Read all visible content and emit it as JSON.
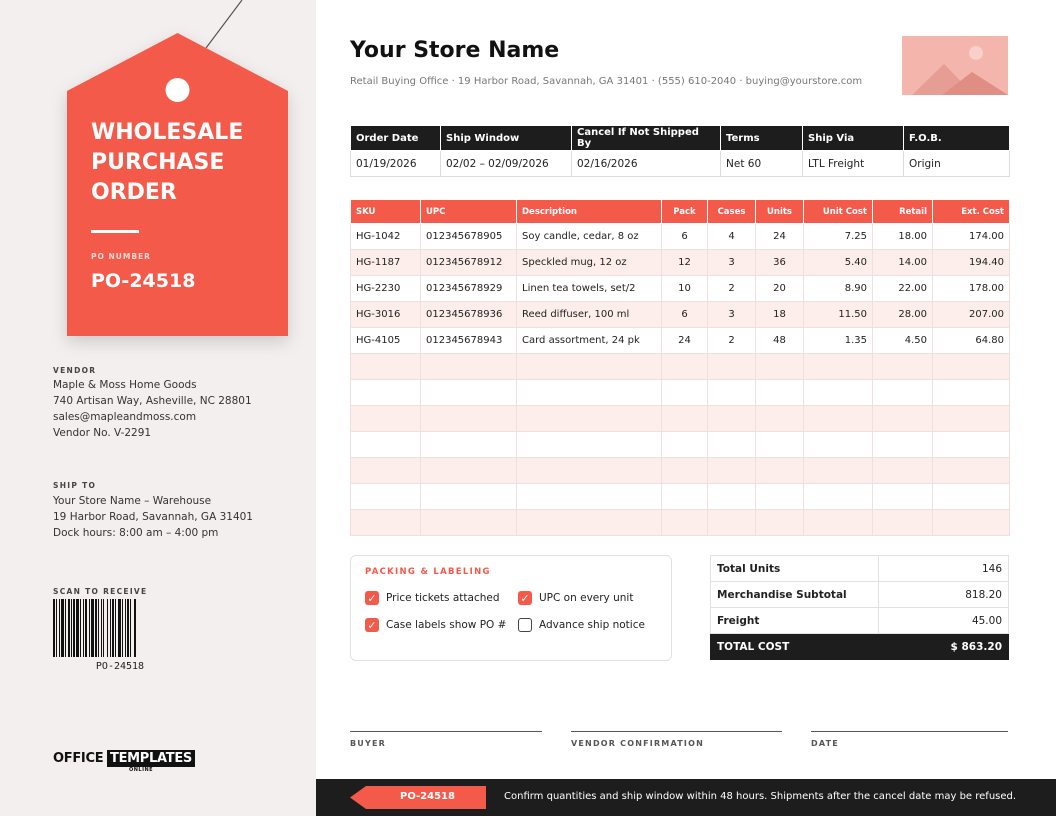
{
  "colors": {
    "accent": "#f45a4a",
    "dark": "#1d1d1d",
    "panel": "#f2efee",
    "row_tint": "#fdeeec"
  },
  "tag": {
    "title": "WHOLESALE\nPURCHASE\nORDER",
    "po_label": "PO NUMBER",
    "po_number": "PO-24518"
  },
  "vendor": {
    "label": "VENDOR",
    "lines": [
      "Maple & Moss Home Goods",
      "740 Artisan Way, Asheville, NC 28801",
      "sales@mapleandmoss.com",
      "Vendor No. V-2291"
    ]
  },
  "ship_to": {
    "label": "SHIP TO",
    "lines": [
      "Your Store Name – Warehouse",
      "19 Harbor Road, Savannah, GA 31401",
      "Dock hours: 8:00 am – 4:00 pm"
    ]
  },
  "scan": {
    "label": "SCAN TO RECEIVE",
    "code": "PO-24518"
  },
  "logo": {
    "office": "OFFICE",
    "templates": "TEMPLATES",
    "online": "ONLINE"
  },
  "store": {
    "name": "Your Store Name",
    "info": "Retail Buying Office  ·  19 Harbor Road, Savannah, GA 31401  ·  (555) 610-2040  ·  buying@yourstore.com",
    "image_icon": "image-placeholder-icon"
  },
  "terms": {
    "headers": [
      "Order Date",
      "Ship Window",
      "Cancel If Not Shipped By",
      "Terms",
      "Ship Via",
      "F.O.B."
    ],
    "values": [
      "01/19/2026",
      "02/02 – 02/09/2026",
      "02/16/2026",
      "Net 60",
      "LTL Freight",
      "Origin"
    ]
  },
  "items": {
    "headers": [
      "SKU",
      "UPC",
      "Description",
      "Pack",
      "Cases",
      "Units",
      "Unit Cost",
      "Retail",
      "Ext. Cost"
    ],
    "rows": [
      [
        "HG-1042",
        "012345678905",
        "Soy candle, cedar, 8 oz",
        "6",
        "4",
        "24",
        "7.25",
        "18.00",
        "174.00"
      ],
      [
        "HG-1187",
        "012345678912",
        "Speckled mug, 12 oz",
        "12",
        "3",
        "36",
        "5.40",
        "14.00",
        "194.40"
      ],
      [
        "HG-2230",
        "012345678929",
        "Linen tea towels, set/2",
        "10",
        "2",
        "20",
        "8.90",
        "22.00",
        "178.00"
      ],
      [
        "HG-3016",
        "012345678936",
        "Reed diffuser, 100 ml",
        "6",
        "3",
        "18",
        "11.50",
        "28.00",
        "207.00"
      ],
      [
        "HG-4105",
        "012345678943",
        "Card assortment, 24 pk",
        "24",
        "2",
        "48",
        "1.35",
        "4.50",
        "64.80"
      ],
      [
        "",
        "",
        "",
        "",
        "",
        "",
        "",
        "",
        ""
      ],
      [
        "",
        "",
        "",
        "",
        "",
        "",
        "",
        "",
        ""
      ],
      [
        "",
        "",
        "",
        "",
        "",
        "",
        "",
        "",
        ""
      ],
      [
        "",
        "",
        "",
        "",
        "",
        "",
        "",
        "",
        ""
      ],
      [
        "",
        "",
        "",
        "",
        "",
        "",
        "",
        "",
        ""
      ],
      [
        "",
        "",
        "",
        "",
        "",
        "",
        "",
        "",
        ""
      ],
      [
        "",
        "",
        "",
        "",
        "",
        "",
        "",
        "",
        ""
      ]
    ]
  },
  "packing": {
    "title": "PACKING & LABELING",
    "checks": [
      {
        "label": "Price tickets attached",
        "checked": true
      },
      {
        "label": "UPC on every unit",
        "checked": true
      },
      {
        "label": "Case labels show PO #",
        "checked": true
      },
      {
        "label": "Advance ship notice",
        "checked": false
      }
    ]
  },
  "totals": {
    "rows": [
      {
        "label": "Total Units",
        "value": "146"
      },
      {
        "label": "Merchandise Subtotal",
        "value": "818.20"
      },
      {
        "label": "Freight",
        "value": "45.00"
      }
    ],
    "grand_label": "TOTAL COST",
    "grand_value": "$ 863.20"
  },
  "signatures": [
    "BUYER",
    "VENDOR CONFIRMATION",
    "DATE"
  ],
  "footer": {
    "po_number": "PO-24518",
    "note": "Confirm quantities and ship window within 48 hours. Shipments after the cancel date may be refused."
  }
}
